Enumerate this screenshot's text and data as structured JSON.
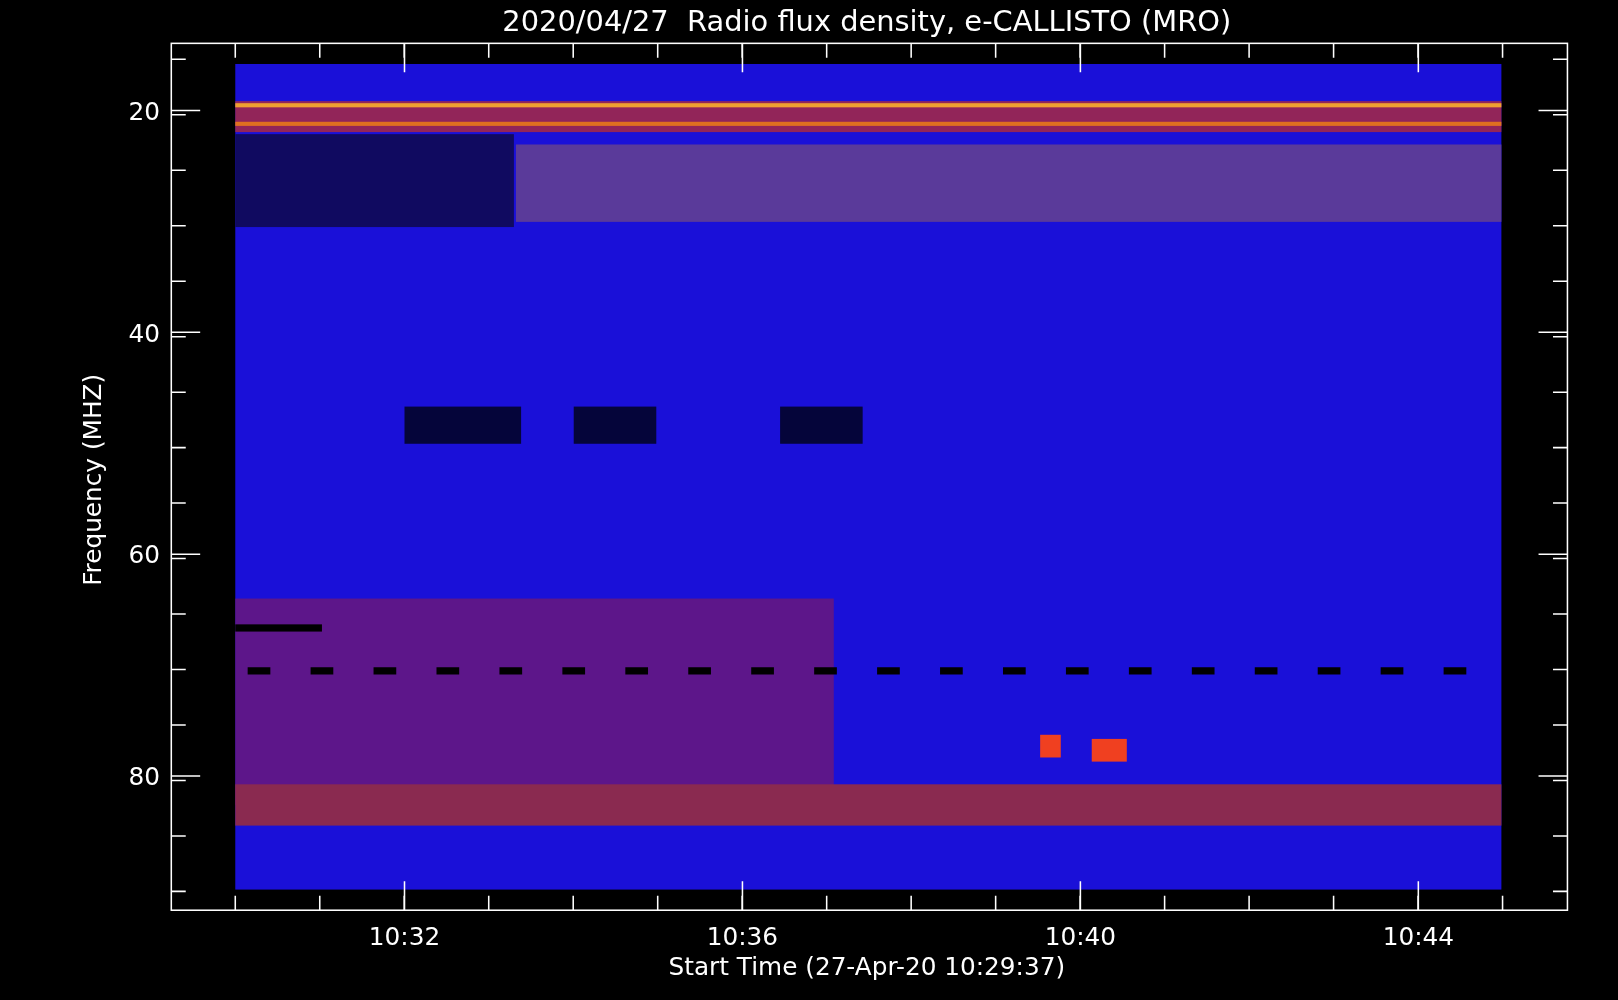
{
  "plot": {
    "title": "2020/04/27  Radio flux density, e-CALLISTO (MRO)",
    "y_axis": {
      "label": "Frequency (MHZ)",
      "ticks": [
        "20",
        "40",
        "60",
        "80"
      ]
    },
    "x_axis": {
      "label": "Start Time (27-Apr-20 10:29:37)",
      "ticks": [
        "10:32",
        "10:36",
        "10:40",
        "10:44"
      ]
    }
  }
}
